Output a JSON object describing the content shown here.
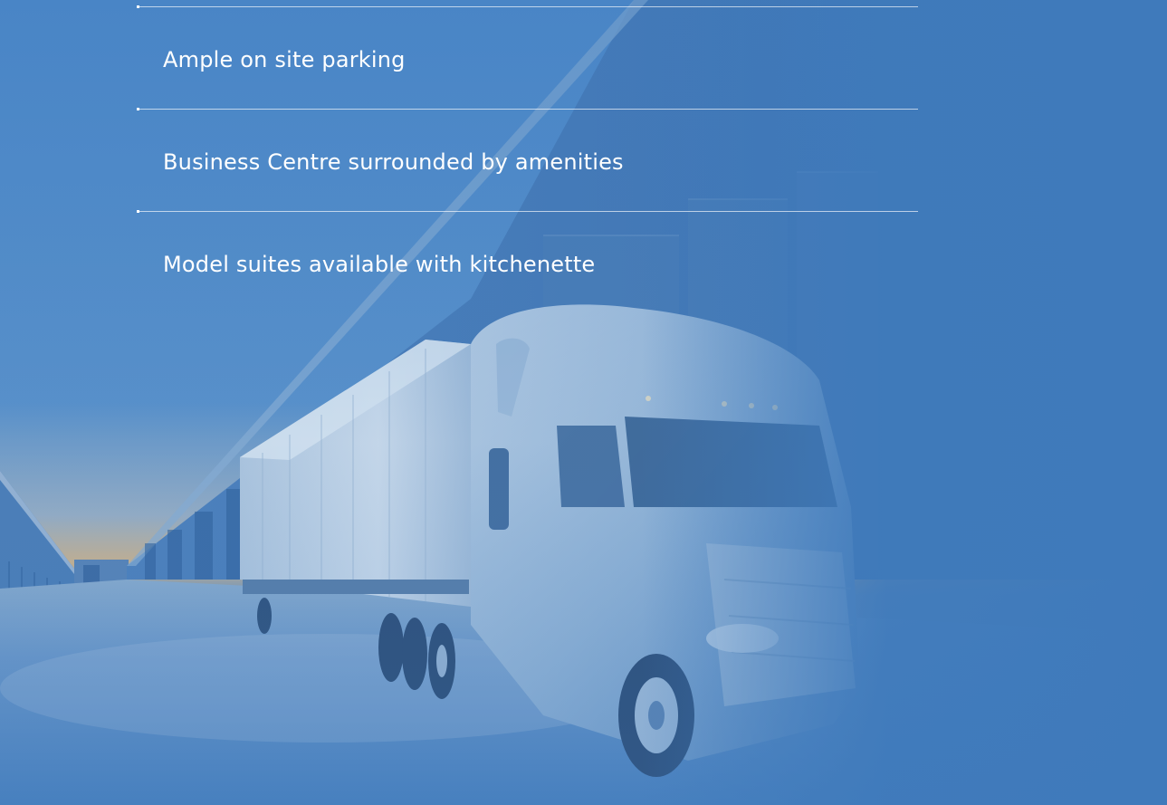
{
  "features": {
    "items": [
      {
        "label": "Ample on site parking"
      },
      {
        "label": "Business Centre surrounded by amenities"
      },
      {
        "label": "Model suites available with kitchenette"
      }
    ]
  },
  "colors": {
    "panel_blue": "#3f7abb",
    "text": "#ffffff",
    "sky_glow": "#d8b88a"
  },
  "background": {
    "image_subject": "semi-truck at industrial warehouse loading docks"
  }
}
